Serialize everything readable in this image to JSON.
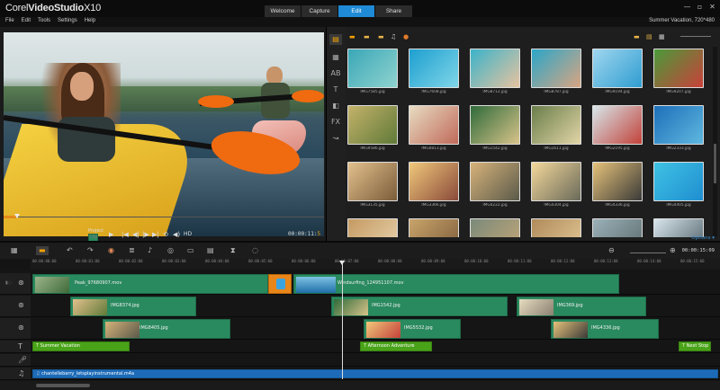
{
  "app": {
    "logo_prefix": "Corel",
    "logo_main": "VideoStudio",
    "logo_suffix": "X10"
  },
  "tabs": [
    {
      "label": "Welcome",
      "active": false
    },
    {
      "label": "Capture",
      "active": false
    },
    {
      "label": "Edit",
      "active": true
    },
    {
      "label": "Share",
      "active": false
    }
  ],
  "window_controls": [
    "—",
    "▫",
    "✕"
  ],
  "menu": [
    "File",
    "Edit",
    "Tools",
    "Settings",
    "Help"
  ],
  "project_info": "Summer Vacation, 720*480",
  "preview": {
    "project_label": "Project",
    "clip_label": "Clip",
    "hd_label": "HD",
    "timecode": "00:00:11:",
    "timecode_end": "5"
  },
  "library": {
    "thumbnails": [
      "IMG7585.jpg",
      "IMG7608.jpg",
      "IMG8712.jpg",
      "IMG8787.jpg",
      "IMG9194.jpg",
      "IMG9207.jpg",
      "IMG9586.jpg",
      "IMG0813.jpg",
      "IMG1542.jpg",
      "IMG1611.jpg",
      "IMG2195.jpg",
      "IMG2333.jpg",
      "IMG3135.jpg",
      "IMG3366.jpg",
      "IMG4222.jpg",
      "IMG4304.jpg",
      "IMG4336.jpg",
      "IMG4405.jpg",
      "",
      "",
      "",
      "",
      "",
      ""
    ],
    "options_label": "Options ▾"
  },
  "timeline": {
    "timecode": "00:00:15:09",
    "ruler_ticks": [
      "00:00:00:00",
      "00:00:01:00",
      "00:00:02:00",
      "00:00:03:00",
      "00:00:04:00",
      "00:00:05:00",
      "00:00:06:00",
      "00:00:07:00",
      "00:00:08:00",
      "00:00:09:00",
      "00:00:10:00",
      "00:00:11:00",
      "00:00:12:00",
      "00:00:13:00",
      "00:00:14:00",
      "00:00:15:00"
    ],
    "video_clips": [
      "Peak_97680907.mov",
      "Windsurfing_124951107.mov"
    ],
    "overlay1_clips": [
      "IMG8374.jpg",
      "IMG1542.jpg",
      "IMG369.jpg"
    ],
    "overlay2_clips": [
      "IMG8405.jpg",
      "IMG5532.jpg",
      "IMG4336.jpg"
    ],
    "titles": [
      "Summer Vacation",
      "Afternoon Adventure",
      "Next Stop"
    ],
    "audio": "chantellebarry_letsplayinstrumental.m4a"
  },
  "colors": {
    "accent": "#1f8ad6",
    "clip_green": "#2a8a5f",
    "title_green": "#49a318",
    "audio_blue": "#1d6bb8",
    "scrub_orange": "#e68a1a"
  }
}
